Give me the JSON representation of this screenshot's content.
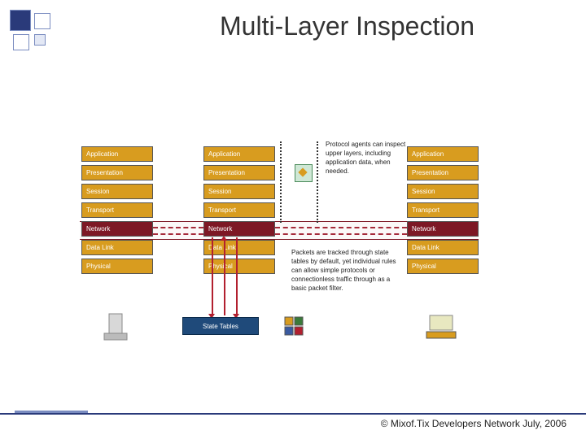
{
  "title": "Multi-Layer Inspection",
  "layers": [
    "Application",
    "Presentation",
    "Session",
    "Transport",
    "Network",
    "Data Link",
    "Physical"
  ],
  "state_tables_label": "State Tables",
  "note_top": "Protocol agents can inspect upper layers, including application data, when needed.",
  "note_bottom": "Packets are tracked through state tables by default, yet individual rules can allow simple protocols or connectionless traffic through as a basic packet filter.",
  "footer": "© Mixof.Tix Developers Network July, 2006"
}
